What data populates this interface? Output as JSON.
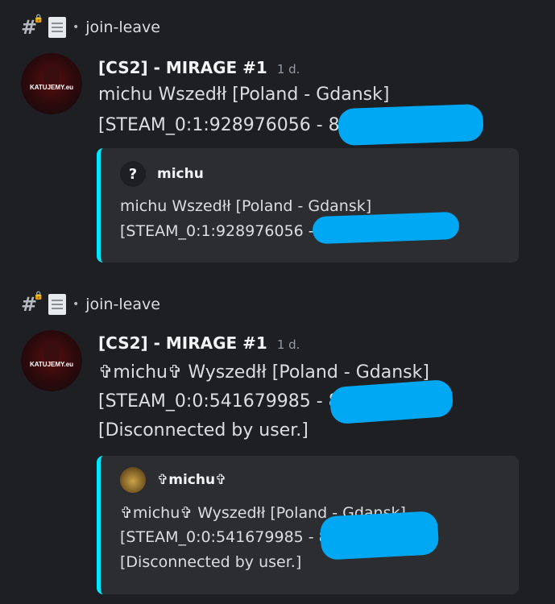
{
  "channel": {
    "name": "join-leave",
    "separator": "•",
    "hash_icon": "hash-icon",
    "lock_icon": "lock-icon",
    "doc_icon": "document-icon"
  },
  "messages": [
    {
      "author": "[CS2] - MIRAGE #1",
      "time": "1 d.",
      "avatar_text": "KATUJEMY.eu",
      "lines": [
        "michu Wszedłł [Poland - Gdansk]",
        "[STEAM_0:1:928976056 - 8"
      ],
      "embed": {
        "author": "michu",
        "icon": "?",
        "lines": [
          "michu Wszedłł [Poland - Gdansk]",
          "[STEAM_0:1:928976056 - "
        ]
      }
    },
    {
      "author": "[CS2] - MIRAGE #1",
      "time": "1 d.",
      "avatar_text": "KATUJEMY.eu",
      "lines": [
        "✞michu✞ Wyszedłł [Poland - Gdansk]",
        "[STEAM_0:0:541679985 - 8",
        "[Disconnected by user.]"
      ],
      "embed": {
        "author": "✞michu✞",
        "lines": [
          "✞michu✞ Wyszedłł [Poland - Gdansk]",
          "[STEAM_0:0:541679985 - 8",
          "[Disconnected by user.]"
        ]
      }
    }
  ],
  "colors": {
    "background": "#1e1f22",
    "embed_bg": "#2b2d31",
    "embed_border": "#00e7ff",
    "redaction": "#00a8f3"
  }
}
